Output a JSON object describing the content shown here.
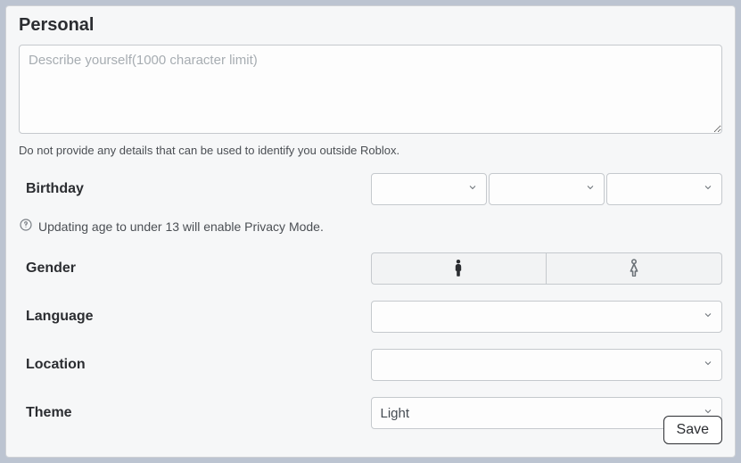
{
  "section": {
    "title": "Personal",
    "description": {
      "placeholder": "Describe yourself(1000 character limit)",
      "value": ""
    },
    "privacy_warning": "Do not provide any details that can be used to identify you outside Roblox."
  },
  "fields": {
    "birthday": {
      "label": "Birthday",
      "month": "",
      "day": "",
      "year": "",
      "note": "Updating age to under 13 will enable Privacy Mode."
    },
    "gender": {
      "label": "Gender",
      "selected": ""
    },
    "language": {
      "label": "Language",
      "value": ""
    },
    "location": {
      "label": "Location",
      "value": ""
    },
    "theme": {
      "label": "Theme",
      "value": "Light"
    }
  },
  "actions": {
    "save": "Save"
  }
}
